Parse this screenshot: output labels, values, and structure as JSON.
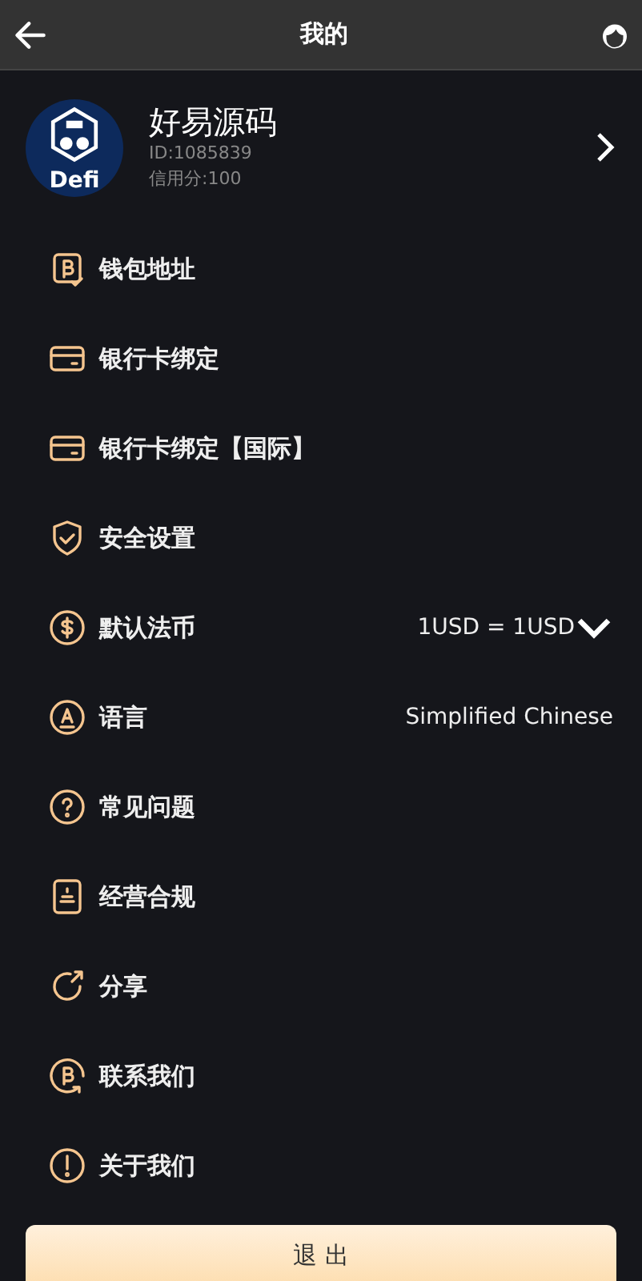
{
  "header": {
    "title": "我的"
  },
  "profile": {
    "avatar_label": "Defi",
    "name": "好易源码",
    "id": "ID:1085839",
    "credit": "信用分:100"
  },
  "menu": [
    {
      "kind": "link",
      "label": "钱包地址"
    },
    {
      "kind": "link",
      "label": "银行卡绑定"
    },
    {
      "kind": "link",
      "label": "银行卡绑定【国际】"
    },
    {
      "kind": "link",
      "label": "安全设置"
    },
    {
      "kind": "select",
      "label": "默认法币",
      "value": "1USD = 1USD"
    },
    {
      "kind": "value",
      "label": "语言",
      "value": "Simplified Chinese"
    },
    {
      "kind": "link",
      "label": "常见问题"
    },
    {
      "kind": "link",
      "label": "经营合规"
    },
    {
      "kind": "link",
      "label": "分享"
    },
    {
      "kind": "link",
      "label": "联系我们"
    },
    {
      "kind": "link",
      "label": "关于我们"
    }
  ],
  "logout": {
    "label": "退 出"
  }
}
